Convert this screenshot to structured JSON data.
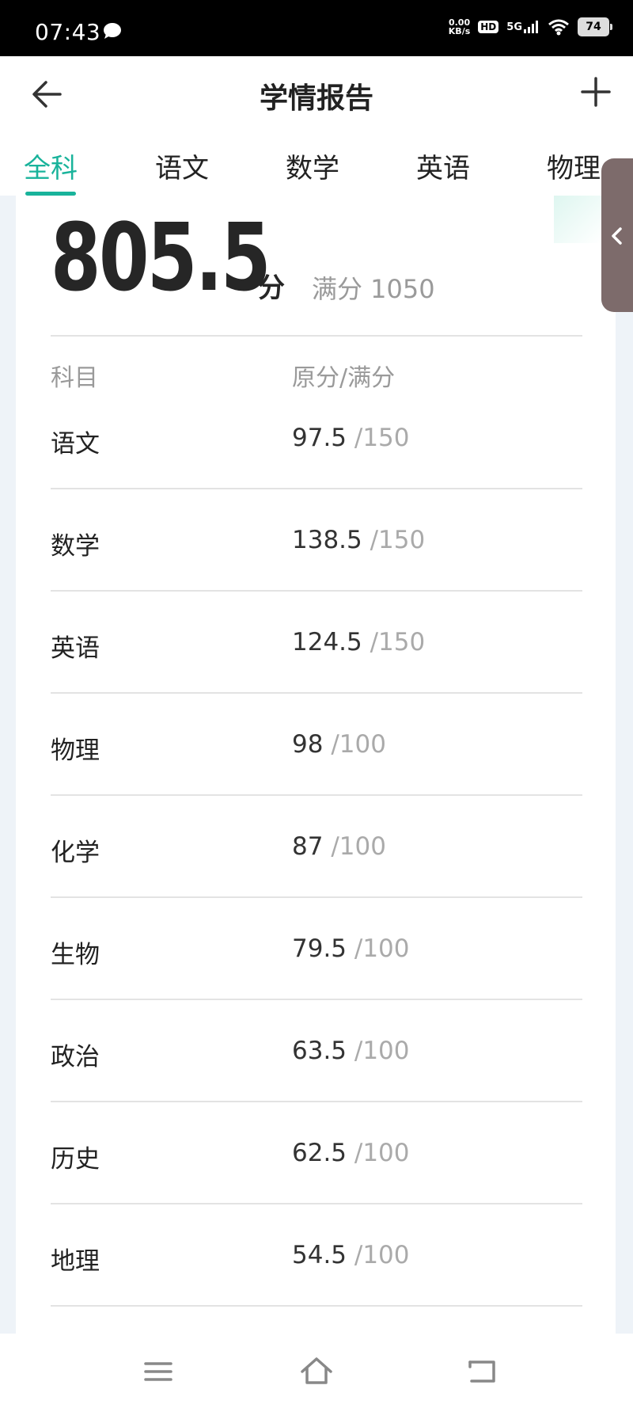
{
  "status_bar": {
    "time": "07:43",
    "net_speed_value": "0.00",
    "net_speed_unit": "KB/s",
    "hd": "HD",
    "network": "5G",
    "battery": "74"
  },
  "header": {
    "title": "学情报告",
    "back_icon": "arrow-left-icon",
    "add_icon": "plus-icon"
  },
  "tabs": [
    {
      "label": "全科",
      "active": true
    },
    {
      "label": "语文",
      "active": false
    },
    {
      "label": "数学",
      "active": false
    },
    {
      "label": "英语",
      "active": false
    },
    {
      "label": "物理",
      "active": false
    }
  ],
  "summary": {
    "total_score": "805.5",
    "unit": "分",
    "full_score_label": "满分 1050"
  },
  "table": {
    "headers": [
      "科目",
      "原分/满分"
    ],
    "rows": [
      {
        "subject": "语文",
        "score": "97.5",
        "max": "/150"
      },
      {
        "subject": "数学",
        "score": "138.5",
        "max": "/150"
      },
      {
        "subject": "英语",
        "score": "124.5",
        "max": "/150"
      },
      {
        "subject": "物理",
        "score": "98",
        "max": "/100"
      },
      {
        "subject": "化学",
        "score": "87",
        "max": "/100"
      },
      {
        "subject": "生物",
        "score": "79.5",
        "max": "/100"
      },
      {
        "subject": "政治",
        "score": "63.5",
        "max": "/100"
      },
      {
        "subject": "历史",
        "score": "62.5",
        "max": "/100"
      },
      {
        "subject": "地理",
        "score": "54.5",
        "max": "/100"
      }
    ]
  },
  "colors": {
    "accent": "#19b39b",
    "muted_text": "#9a9a9a",
    "page_bg": "#eef3f8"
  }
}
